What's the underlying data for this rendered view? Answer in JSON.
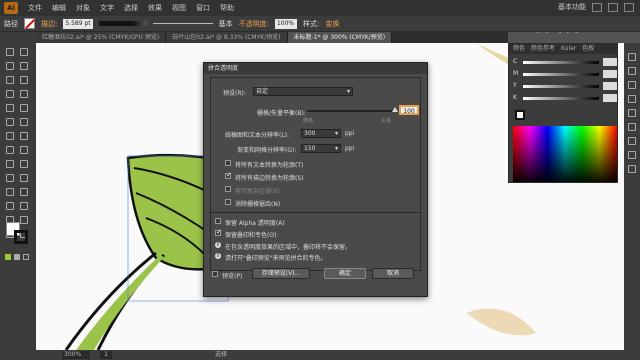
{
  "menubar": {
    "logo": "Ai",
    "items": [
      "文件",
      "编辑",
      "对象",
      "文字",
      "选择",
      "效果",
      "视图",
      "窗口",
      "帮助"
    ],
    "workspace": "基本功能"
  },
  "controlbar": {
    "label": "路径",
    "stroke_label": "描边:",
    "stroke_value": "5.589 pt",
    "style_label": "基本",
    "opacity_label": "不透明度:",
    "opacity_value": "100%",
    "style2_label": "样式:",
    "align_label": "变换"
  },
  "tabs": [
    "红糖酒坊02.ai* @ 25% (CMYK/GPU 预览)",
    "玩叶山包02.ai* @ 8.33% (CMYK/预览)",
    "未标题-1* @ 300% (CMYK/预览)"
  ],
  "watermark": "虎课网",
  "panel": {
    "tabs": [
      "颜色",
      "颜色参考",
      "Kuler",
      "色板"
    ],
    "channels": [
      "C",
      "M",
      "Y",
      "K"
    ]
  },
  "status": {
    "zoom": "300%",
    "page": "1",
    "tool": "选择"
  },
  "dialog": {
    "title": "拼合透明度",
    "preset_label": "预设(R):",
    "preset_value": "自定",
    "raster_vector_label": "栅格/矢量平衡(B):",
    "raster_min": "栅格",
    "raster_max": "矢量",
    "raster_value": "100",
    "line_art_label": "线稿图和文本分辨率(L):",
    "line_art_value": "300",
    "line_art_unit": "ppi",
    "gradient_label": "渐变和网格分辨率(G):",
    "gradient_value": "150",
    "gradient_unit": "ppi",
    "opt_text_outline": "将所有文本转换为轮廓(T)",
    "opt_stroke_outline": "将所有描边转换为轮廓(S)",
    "opt_clip": "剪切复杂区域(X)",
    "opt_antialias": "消除栅格锯齿(N)",
    "opt_alpha": "保留 Alpha 透明度(A)",
    "opt_overprint": "保留叠印和专色(O)",
    "info1": "在包含透明度效果的区域中，叠印将不会保留。",
    "info2": "请打开\"叠印预览\"来预览拼合的专色。",
    "preview": "预览(P)",
    "save_preset": "存储预设(V)...",
    "ok": "确定",
    "cancel": "取消"
  }
}
